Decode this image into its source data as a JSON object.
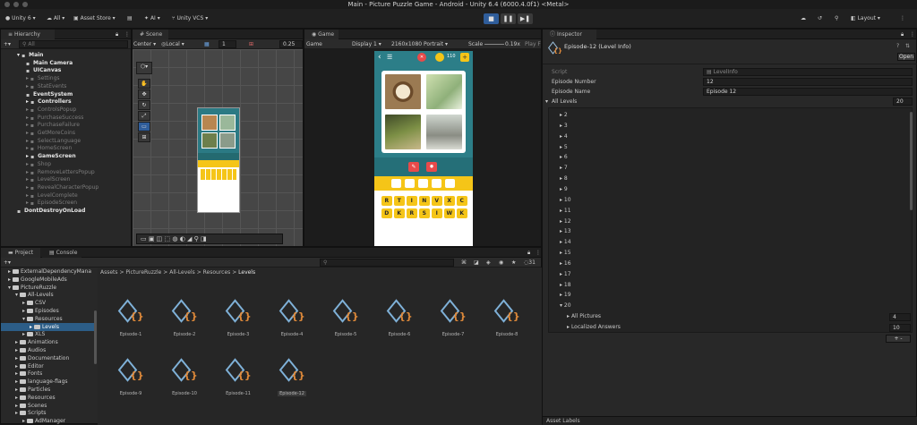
{
  "window": {
    "title": "Main - Picture Puzzle Game - Android - Unity 6.4 (6000.4.0f1) <Metal>"
  },
  "toolbar": {
    "account": "Unity 6",
    "all": "All",
    "asset_store": "Asset Store",
    "ai": "AI",
    "vcs": "Unity VCS",
    "layout": "Layout"
  },
  "hierarchy": {
    "tab": "Hierarchy",
    "search_placeholder": "All",
    "rows": [
      {
        "label": "Main",
        "style": "bold"
      },
      {
        "label": "Main Camera",
        "style": "bold"
      },
      {
        "label": "UICanvas",
        "style": "bold"
      },
      {
        "label": "Settings",
        "style": "dim"
      },
      {
        "label": "StatEvents",
        "style": "dim"
      },
      {
        "label": "EventSystem",
        "style": "bold"
      },
      {
        "label": "Controllers",
        "style": "bold"
      },
      {
        "label": "ControlsPopup",
        "style": "dim"
      },
      {
        "label": "PurchaseSuccess",
        "style": "dim"
      },
      {
        "label": "PurchaseFailure",
        "style": "dim"
      },
      {
        "label": "GetMoreCoins",
        "style": "dim"
      },
      {
        "label": "SelectLanguage",
        "style": "dim"
      },
      {
        "label": "HomeScreen",
        "style": "dim"
      },
      {
        "label": "GameScreen",
        "style": "bold"
      },
      {
        "label": "Shop",
        "style": "dim"
      },
      {
        "label": "RemoveLettersPopup",
        "style": "dim"
      },
      {
        "label": "LevelScreen",
        "style": "dim"
      },
      {
        "label": "RevealCharacterPopup",
        "style": "dim"
      },
      {
        "label": "LevelComplete",
        "style": "dim"
      },
      {
        "label": "EpisodeScreen",
        "style": "dim"
      },
      {
        "label": "DontDestroyOnLoad",
        "style": "bold"
      }
    ]
  },
  "scene": {
    "tab": "Scene",
    "pivot": "Center",
    "space": "Local",
    "grid_value": "1",
    "snap_value": "0.25"
  },
  "game": {
    "tab": "Game",
    "mode": "Game",
    "display": "Display 1",
    "resolution": "2160x1080 Portrait",
    "scale_label": "Scale",
    "scale_value": "0.19x",
    "play_label": "Play F",
    "coins": "110",
    "row1_letters": [
      "R",
      "T",
      "I",
      "N",
      "V",
      "X",
      "C"
    ],
    "row2_letters": [
      "D",
      "K",
      "R",
      "S",
      "I",
      "W",
      "K"
    ]
  },
  "inspector": {
    "tab": "Inspector",
    "object_title": "Episode-12 (Level Info)",
    "open_button": "Open",
    "script_label": "Script",
    "script_value": "LevelInfo",
    "episode_number_label": "Episode Number",
    "episode_number_value": "12",
    "episode_name_label": "Episode Name",
    "episode_name_value": "Episode 12",
    "all_levels_label": "All Levels",
    "all_levels_count": "20",
    "levels": [
      "2",
      "3",
      "4",
      "5",
      "6",
      "7",
      "8",
      "9",
      "10",
      "11",
      "12",
      "13",
      "14",
      "15",
      "16",
      "17",
      "18",
      "19",
      "20"
    ],
    "all_pictures_label": "All Pictures",
    "all_pictures_value": "4",
    "localized_label": "Localized Answers",
    "localized_value": "10",
    "add_remove": "+ -",
    "footer": "Asset Labels"
  },
  "project": {
    "tab": "Project",
    "console_tab": "Console",
    "count": "31",
    "breadcrumb": [
      "Assets",
      "PictureRuzzle",
      "All-Levels",
      "Resources",
      "Levels"
    ],
    "tree": [
      {
        "label": "ExternalDependencyMana",
        "depth": 1
      },
      {
        "label": "GoogleMobileAds",
        "depth": 1
      },
      {
        "label": "PictureRuzzle",
        "depth": 1
      },
      {
        "label": "All-Levels",
        "depth": 2
      },
      {
        "label": "CSV",
        "depth": 3
      },
      {
        "label": "Episodes",
        "depth": 3
      },
      {
        "label": "Resources",
        "depth": 3
      },
      {
        "label": "Levels",
        "depth": 4,
        "selected": true
      },
      {
        "label": "XLS",
        "depth": 3
      },
      {
        "label": "Animations",
        "depth": 2
      },
      {
        "label": "Audios",
        "depth": 2
      },
      {
        "label": "Documentation",
        "depth": 2
      },
      {
        "label": "Editor",
        "depth": 2
      },
      {
        "label": "Fonts",
        "depth": 2
      },
      {
        "label": "language-flags",
        "depth": 2
      },
      {
        "label": "Particles",
        "depth": 2
      },
      {
        "label": "Resources",
        "depth": 2
      },
      {
        "label": "Scenes",
        "depth": 2
      },
      {
        "label": "Scripts",
        "depth": 2
      },
      {
        "label": "AdManager",
        "depth": 3
      }
    ],
    "assets": [
      "Episode-1",
      "Episode-2",
      "Episode-3",
      "Episode-4",
      "Episode-5",
      "Episode-6",
      "Episode-7",
      "Episode-8",
      "Episode-9",
      "Episode-10",
      "Episode-11",
      "Episode-12"
    ]
  }
}
